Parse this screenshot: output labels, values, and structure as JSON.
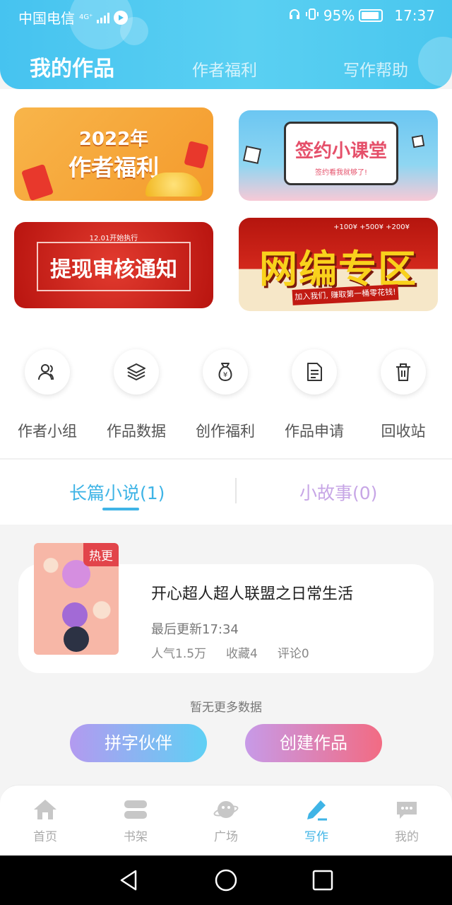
{
  "status_bar": {
    "carrier": "中国电信",
    "network": "4G⁺",
    "battery": "95%",
    "time": "17:37"
  },
  "top_tabs": [
    "我的作品",
    "作者福利",
    "写作帮助"
  ],
  "banners": {
    "b1_year": "2022年",
    "b1_title": "作者福利",
    "b2_title": "签约小课堂",
    "b2_sub": "签约看我就够了!",
    "b3_small": "12.01开始执行",
    "b3_title": "提现审核通知",
    "b4_title": "网编专区",
    "b4_strip": "加入我们, 赚取第一桶零花钱!",
    "b4_tags": "+100¥  +500¥  +200¥"
  },
  "shortcuts": [
    {
      "label": "作者小组",
      "icon": "users-icon"
    },
    {
      "label": "作品数据",
      "icon": "layers-icon"
    },
    {
      "label": "创作福利",
      "icon": "money-bag-icon"
    },
    {
      "label": "作品申请",
      "icon": "document-icon"
    },
    {
      "label": "回收站",
      "icon": "trash-icon"
    }
  ],
  "work_tabs": {
    "long": "长篇小说(1)",
    "short": "小故事(0)"
  },
  "work": {
    "badge": "热更",
    "title": "开心超人超人联盟之日常生活",
    "updated": "最后更新17:34",
    "popularity": "人气1.5万",
    "favorites": "收藏4",
    "comments": "评论0"
  },
  "no_more": "暂无更多数据",
  "actions": {
    "partner": "拼字伙伴",
    "create": "创建作品"
  },
  "bottom_nav": [
    {
      "label": "首页",
      "icon": "home-icon"
    },
    {
      "label": "书架",
      "icon": "bookshelf-icon"
    },
    {
      "label": "广场",
      "icon": "planet-icon"
    },
    {
      "label": "写作",
      "icon": "pen-icon"
    },
    {
      "label": "我的",
      "icon": "chat-bubble-icon"
    }
  ],
  "colors": {
    "accent": "#3fb4e6",
    "secondary_tab": "#c7a6e6",
    "hot_badge": "#e2444a"
  }
}
